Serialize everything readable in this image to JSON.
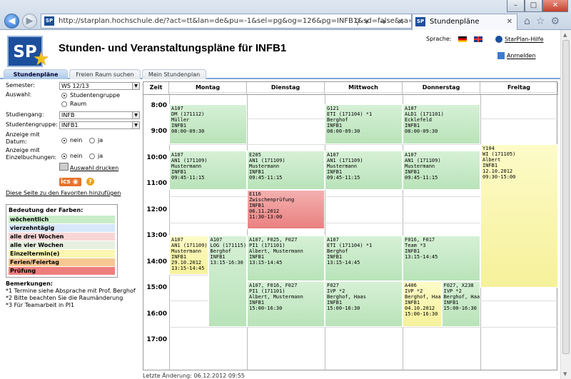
{
  "browser": {
    "url": "http://starplan.hochschule.de/?act=tt&lan=de&pu=-1&sel=pg&og=126&pg=INFB1&sd=false&sa=false",
    "tab_title": "Stundenpläne",
    "favicon_text": "SP"
  },
  "header": {
    "logo_text": "SP",
    "title": "Stunden- und Veranstaltungspläne für INFB1",
    "language_label": "Sprache:",
    "help_link": "StarPlan-Hilfe",
    "login_link": "Anmelden"
  },
  "page_tabs": [
    "Stundenpläne",
    "Freien Raum suchen",
    "Mein Stundenplan"
  ],
  "filters": {
    "semester_label": "Semester:",
    "semester_value": "WS 12/13",
    "auswahl_label": "Auswahl:",
    "auswahl_opt1": "Studentengruppe",
    "auswahl_opt2": "Raum",
    "studiengang_label": "Studiengang:",
    "studiengang_value": "INFB",
    "studentengruppe_label": "Studentengruppe:",
    "studentengruppe_value": "INFB1",
    "datum_label_1": "Anzeige mit",
    "datum_label_2": "Datum:",
    "einzel_label_1": "Anzeige mit",
    "einzel_label_2": "Einzelbuchungen:",
    "opt_nein": "nein",
    "opt_ja": "ja",
    "print_link": "Auswahl drucken",
    "ics_label": "ics",
    "favorites_link": "Diese Seite zu den Favoriten hinzufügen"
  },
  "legend": {
    "title": "Bedeutung der Farben:",
    "items": [
      {
        "label": "wöchentlich",
        "color": "#c8ecc8"
      },
      {
        "label": "vierzehntägig",
        "color": "#d8e8fb"
      },
      {
        "label": "alle drei Wochen",
        "color": "#f8d6d6"
      },
      {
        "label": "alle vier Wochen",
        "color": "#e7f0e0"
      },
      {
        "label": "Einzeltermin(e)",
        "color": "#fbf7b2"
      },
      {
        "label": "Ferien/Feiertag",
        "color": "#f7c790"
      },
      {
        "label": "Prüfung",
        "color": "#ee7e7e"
      }
    ]
  },
  "remarks": {
    "title": "Bemerkungen:",
    "lines": [
      "*1 Termine siehe Absprache mit Prof. Berghof",
      "*2 Bitte beachten Sie die Raumänderung",
      "*3 Für Teamarbeit in PI1"
    ]
  },
  "timetable": {
    "time_header": "Zeit",
    "days": [
      "Montag",
      "Dienstag",
      "Mittwoch",
      "Donnerstag",
      "Freitag"
    ],
    "hours": [
      "8:00",
      "9:00",
      "10:00",
      "11:00",
      "12:00",
      "13:00",
      "14:00",
      "15:00",
      "16:00",
      "17:00"
    ],
    "events": [
      {
        "day": 0,
        "start": 7.95,
        "end": 9.5,
        "sub": 0,
        "subs": 1,
        "color": "green",
        "lines": [
          "A107",
          "DM (171112)",
          "Müller",
          "INFB1",
          "08:00-09:30"
        ]
      },
      {
        "day": 2,
        "start": 7.95,
        "end": 9.5,
        "sub": 0,
        "subs": 1,
        "color": "green",
        "lines": [
          "G121",
          "ETI (171104) *1",
          "Berghof",
          "INFB1",
          "08:00-09:30"
        ]
      },
      {
        "day": 3,
        "start": 7.95,
        "end": 9.5,
        "sub": 0,
        "subs": 1,
        "color": "green",
        "lines": [
          "A107",
          "ALD1 (171101)",
          "Ecklefeld",
          "INFB1",
          "08:00-09:30"
        ]
      },
      {
        "day": 4,
        "start": 9.5,
        "end": 15.0,
        "sub": 0,
        "subs": 1,
        "color": "yellow",
        "lines": [
          "Y104",
          "WI (171105)",
          "Albert",
          "INFB1",
          "12.10.2012",
          "09:30-15:00"
        ]
      },
      {
        "day": 0,
        "start": 9.75,
        "end": 11.25,
        "sub": 0,
        "subs": 1,
        "color": "green",
        "lines": [
          "A107",
          "AN1 (171109)",
          "Mustermann",
          "INFB1",
          "09:45-11:15"
        ]
      },
      {
        "day": 1,
        "start": 9.75,
        "end": 11.25,
        "sub": 0,
        "subs": 1,
        "color": "green",
        "lines": [
          "E205",
          "AN1 (171109)",
          "Mustermann",
          "INFB1",
          "09:45-11:15"
        ]
      },
      {
        "day": 2,
        "start": 9.75,
        "end": 11.25,
        "sub": 0,
        "subs": 1,
        "color": "green",
        "lines": [
          "A107",
          "AN1 (171109)",
          "Mustermann",
          "INFB1",
          "09:45-11:15"
        ]
      },
      {
        "day": 3,
        "start": 9.75,
        "end": 11.25,
        "sub": 0,
        "subs": 1,
        "color": "green",
        "lines": [
          "A107",
          "AN1 (171109)",
          "Mustermann",
          "INFB1",
          "09:45-11:15"
        ]
      },
      {
        "day": 1,
        "start": 11.25,
        "end": 12.75,
        "sub": 0,
        "subs": 1,
        "color": "red",
        "lines": [
          "E116",
          "Zwischenprüfung",
          "INFB1",
          "06.11.2012",
          "11:30-13:00"
        ]
      },
      {
        "day": 0,
        "start": 13.0,
        "end": 14.5,
        "sub": 0,
        "subs": 2,
        "color": "yellow",
        "lines": [
          "A107",
          "AN1 (171109)",
          "Mustermann",
          "INFB1",
          "29.10.2012",
          "13:15-14:45"
        ]
      },
      {
        "day": 0,
        "start": 13.0,
        "end": 16.5,
        "sub": 1,
        "subs": 2,
        "color": "green",
        "lines": [
          "A107",
          "LOG (171115)",
          "Berghof",
          "INFB1",
          "13:15-16:30"
        ]
      },
      {
        "day": 1,
        "start": 13.0,
        "end": 14.75,
        "sub": 0,
        "subs": 1,
        "color": "green",
        "lines": [
          "A107, F025, F027",
          "PI1 (171101)",
          "Albert, Mustermann",
          "INFB1",
          "13:15-14:45"
        ]
      },
      {
        "day": 2,
        "start": 13.0,
        "end": 14.75,
        "sub": 0,
        "subs": 1,
        "color": "green",
        "lines": [
          "A107",
          "ETI (171104) *1",
          "Berghof",
          "INFB1",
          "13:15-14:45"
        ]
      },
      {
        "day": 3,
        "start": 13.0,
        "end": 14.75,
        "sub": 0,
        "subs": 1,
        "color": "green",
        "lines": [
          "F016, F017",
          "Team *3",
          "INFB1",
          "13:15-14:45"
        ]
      },
      {
        "day": 1,
        "start": 14.75,
        "end": 16.5,
        "sub": 0,
        "subs": 1,
        "color": "green",
        "lines": [
          "A107, F016, F027",
          "PI1 (171101)",
          "Albert, Mustermann",
          "INFB1",
          "15:00-16:30"
        ]
      },
      {
        "day": 2,
        "start": 14.75,
        "end": 16.5,
        "sub": 0,
        "subs": 1,
        "color": "green",
        "lines": [
          "F027",
          "IVP *2",
          "Berghof, Haas",
          "INFB1",
          "15:00-16:30"
        ]
      },
      {
        "day": 3,
        "start": 14.75,
        "end": 16.5,
        "sub": 0,
        "subs": 2,
        "color": "yellow",
        "lines": [
          "A406",
          "IVP *2",
          "Berghof, Haas",
          "INFB1",
          "04.10.2012",
          "15:00-16:30"
        ]
      },
      {
        "day": 3,
        "start": 14.75,
        "end": 16.5,
        "sub": 1,
        "subs": 2,
        "color": "green",
        "lines": [
          "F027, X238",
          "IVP *2",
          "Berghof, Haas",
          "INFB1",
          "15:00-16:30"
        ]
      }
    ]
  },
  "footer": "Letzte Änderung: 06.12.2012 09:55"
}
